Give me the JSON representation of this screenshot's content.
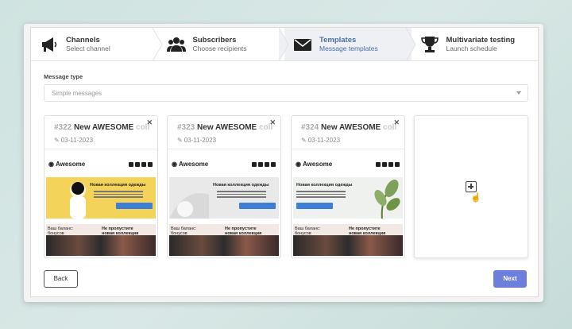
{
  "stepper": [
    {
      "title": "Channels",
      "subtitle": "Select channel",
      "icon": "megaphone-icon"
    },
    {
      "title": "Subscribers",
      "subtitle": "Choose recipients",
      "icon": "users-icon"
    },
    {
      "title": "Templates",
      "subtitle": "Message templates",
      "icon": "envelope-icon"
    },
    {
      "title": "Multivariate testing",
      "subtitle": "Launch schedule",
      "icon": "trophy-icon"
    }
  ],
  "active_step": 2,
  "message_type": {
    "label": "Message type",
    "value": "Simple messages"
  },
  "templates": [
    {
      "number": "#322",
      "name": "New AWESOME",
      "name_fade": "coll",
      "date": "03-11-2023",
      "brand": "Awesome",
      "banner_title": "Новая коллекция одежды",
      "promo_left": "Ваш баланс:\nбонусов",
      "promo_right": "Не пропустите\nновая коллекция\nуже здесь"
    },
    {
      "number": "#323",
      "name": "New AWESOME",
      "name_fade": "coll",
      "date": "03-11-2023",
      "brand": "Awesome",
      "banner_title": "Новая коллекция одежды",
      "promo_left": "Ваш баланс:\nбонусов",
      "promo_right": "Не пропустите\nновая коллекция\nуже здесь"
    },
    {
      "number": "#324",
      "name": "New AWESOME",
      "name_fade": "coll",
      "date": "03-11-2023",
      "brand": "Awesome",
      "banner_title": "Новая коллекция одежды",
      "promo_left": "Ваш баланс:\nбонусов",
      "promo_right": "Не пропустите\nновая коллекция\nуже здесь"
    }
  ],
  "close_glyph": "✕",
  "buttons": {
    "back": "Back",
    "next": "Next"
  },
  "colors": {
    "accent": "#6d7fdc",
    "active_step_text": "#4a6fa5",
    "banner_1": "#f3d35a",
    "banner_2": "#e9e9e9",
    "banner_3": "#eef1ee"
  }
}
